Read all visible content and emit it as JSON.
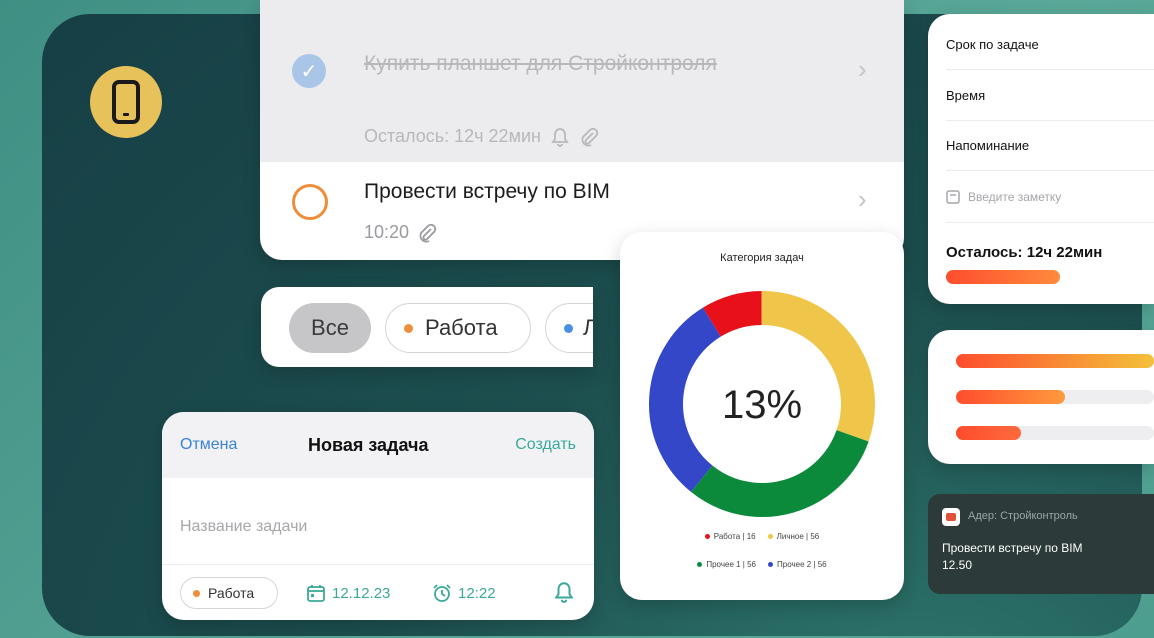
{
  "tasks": {
    "done_task": {
      "title": "Купить планшет для Стройконтроля",
      "remaining": "Осталось: 12ч 22мин"
    },
    "active_task": {
      "title": "Провести встречу по BIM",
      "time": "10:20"
    }
  },
  "filters": {
    "all": "Все",
    "work": "Работа",
    "third": "Л"
  },
  "new_task": {
    "cancel": "Отмена",
    "title": "Новая задача",
    "create": "Создать",
    "name_placeholder": "Название  задачи",
    "category": "Работа",
    "date": "12.12.23",
    "time": "12:22"
  },
  "chart_data": {
    "type": "pie",
    "title": "Категория задач",
    "center_label": "13%",
    "slices": [
      {
        "name": "Работа",
        "value": 16,
        "color": "#e8111a"
      },
      {
        "name": "Личное",
        "value": 56,
        "color": "#f0c64a"
      },
      {
        "name": "Прочее 1",
        "value": 56,
        "color": "#0c8a3c"
      },
      {
        "name": "Прочее 2",
        "value": 56,
        "color": "#3447c9"
      }
    ],
    "legend": [
      {
        "label": "Работа | 16",
        "color": "#e8111a"
      },
      {
        "label": "Личное | 56",
        "color": "#f0c64a"
      },
      {
        "label": "Прочее 1 | 56",
        "color": "#0c8a3c"
      },
      {
        "label": "Прочее 2 | 56",
        "color": "#3447c9"
      }
    ]
  },
  "detail": {
    "deadline": "Срок по задаче",
    "time": "Время",
    "reminder": "Напоминание",
    "note_placeholder": "Введите заметку",
    "remaining": "Осталось: 12ч 22мин",
    "remaining_progress": 0.5
  },
  "progress_bars": [
    {
      "fraction": 1.0,
      "from": "#ff4d2e",
      "to": "#f3c13a"
    },
    {
      "fraction": 0.55,
      "from": "#ff4d2e",
      "to": "#ff9a3c"
    },
    {
      "fraction": 0.33,
      "from": "#ff4d2e",
      "to": "#ff6a3c"
    }
  ],
  "notification": {
    "app": "Адер: Стройконтроль",
    "text_line1": "Провести встречу по BIM",
    "text_line2": "12.50"
  },
  "colors": {
    "accent": "#3ba99a",
    "link": "#3b82d6",
    "work_dot": "#ee8d3a",
    "blue_dot": "#4a90e2"
  }
}
